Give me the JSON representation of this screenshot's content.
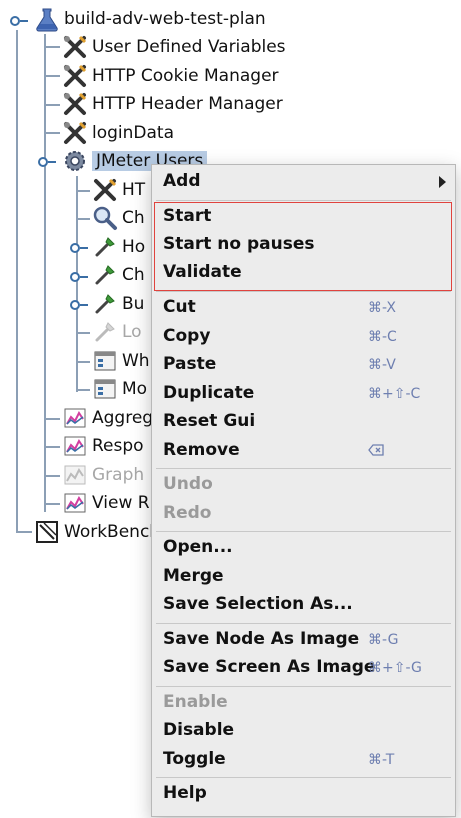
{
  "tree": {
    "root": {
      "label": "build-adv-web-test-plan",
      "icon": "flask-icon"
    },
    "config_items": [
      {
        "label": "User Defined Variables",
        "icon": "wrench-icon"
      },
      {
        "label": "HTTP Cookie Manager",
        "icon": "wrench-icon"
      },
      {
        "label": "HTTP Header Manager",
        "icon": "wrench-icon"
      },
      {
        "label": "loginData",
        "icon": "wrench-icon"
      }
    ],
    "thread_group": {
      "label": "JMeter Users",
      "icon": "gear-icon"
    },
    "thread_children": [
      {
        "label": "HT",
        "icon": "wrench-icon"
      },
      {
        "label": "Ch",
        "icon": "magnifier-icon"
      },
      {
        "label": "Ho",
        "icon": "dropper-icon"
      },
      {
        "label": "Ch",
        "icon": "dropper-icon"
      },
      {
        "label": "Bu",
        "icon": "dropper-icon"
      },
      {
        "label": "Lo",
        "icon": "dropper-icon",
        "disabled": true
      },
      {
        "label": "Wh",
        "icon": "controller-icon"
      },
      {
        "label": "Mo",
        "icon": "controller-icon"
      }
    ],
    "listeners": [
      {
        "label": "Aggreg",
        "icon": "graph-icon"
      },
      {
        "label": "Respo",
        "icon": "graph-icon"
      },
      {
        "label": "Graph",
        "icon": "graph-icon",
        "disabled": true
      },
      {
        "label": "View R",
        "icon": "graph-icon"
      }
    ],
    "workbench": {
      "label": "WorkBench",
      "icon": "workbench-icon"
    }
  },
  "menu": {
    "add": {
      "label": "Add",
      "icon": "chevron-right-icon"
    },
    "run": {
      "start": "Start",
      "start_no_pauses": "Start no pauses",
      "validate": "Validate"
    },
    "edit": {
      "cut": {
        "label": "Cut",
        "shortcut": "⌘-X"
      },
      "copy": {
        "label": "Copy",
        "shortcut": "⌘-C"
      },
      "paste": {
        "label": "Paste",
        "shortcut": "⌘-V"
      },
      "duplicate": {
        "label": "Duplicate",
        "shortcut": "⌘+⇧-C"
      },
      "reset_gui": {
        "label": "Reset Gui"
      },
      "remove": {
        "label": "Remove",
        "icon": "delete-key-icon"
      }
    },
    "history": {
      "undo": {
        "label": "Undo",
        "disabled": true
      },
      "redo": {
        "label": "Redo",
        "disabled": true
      }
    },
    "file": {
      "open": "Open...",
      "merge": "Merge",
      "save_selection": "Save Selection As..."
    },
    "image": {
      "save_node": {
        "label": "Save Node As Image",
        "shortcut": "⌘-G"
      },
      "save_screen": {
        "label": "Save Screen As Image",
        "shortcut": "⌘+⇧-G"
      }
    },
    "state": {
      "enable": {
        "label": "Enable",
        "disabled": true
      },
      "disable": {
        "label": "Disable"
      },
      "toggle": {
        "label": "Toggle",
        "shortcut": "⌘-T"
      }
    },
    "help": "Help"
  },
  "colors": {
    "highlight_box": "#e0433e",
    "selection": "#b8cce4",
    "shortcut_text": "#6e7fb0",
    "menu_bg": "#ececec"
  }
}
